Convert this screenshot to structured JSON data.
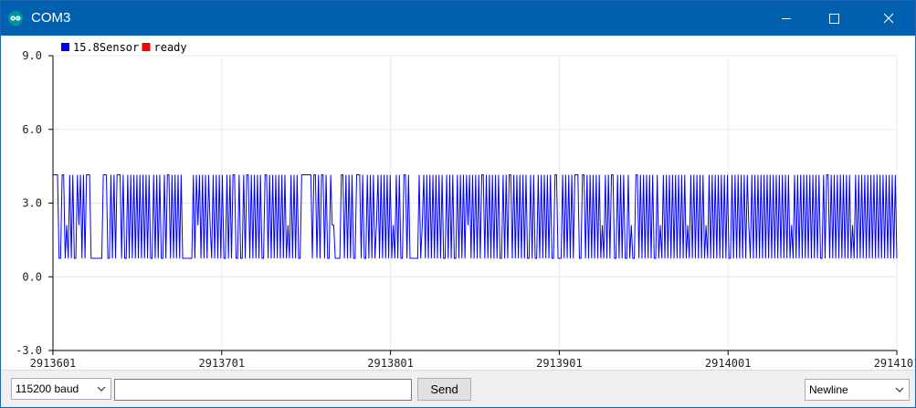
{
  "window": {
    "title": "COM3",
    "icon": "arduino-icon",
    "controls": [
      "minimize-icon",
      "maximize-icon",
      "close-icon"
    ]
  },
  "colors": {
    "titlebar": "#0060b0",
    "series_sensor": "#0000ff",
    "series_ready": "#ff0000",
    "grid": "#e8e8e8"
  },
  "legend": [
    {
      "label": "15.8Sensor",
      "color": "#0000ff"
    },
    {
      "label": "ready",
      "color": "#ff0000"
    }
  ],
  "chart_data": {
    "type": "line",
    "y_ticks": [
      "9.0",
      "6.0",
      "3.0",
      "0.0",
      "-3.0"
    ],
    "ylim": [
      -3.0,
      9.0
    ],
    "x_ticks": [
      "2913601",
      "2913701",
      "2913801",
      "2913901",
      "2914001",
      "2914101"
    ],
    "xlim": [
      2913601,
      2914101
    ],
    "grid": true,
    "legend_position": "top-left",
    "series": [
      {
        "name": "15.8Sensor",
        "color": "#0000ff",
        "levels": [
          0.75,
          2.1,
          4.15
        ],
        "values": [
          4.15,
          4.15,
          4.15,
          4.15,
          0.75,
          0.75,
          4.15,
          4.15,
          0.75,
          2.1,
          0.75,
          4.15,
          0.75,
          4.15,
          0.75,
          0.75,
          4.15,
          2.1,
          4.15,
          0.75,
          4.15,
          0.75,
          4.15,
          4.15,
          4.15,
          0.75,
          0.75,
          0.75,
          0.75,
          0.75,
          0.75,
          0.75,
          0.75,
          4.15,
          4.15,
          4.15,
          0.75,
          0.75,
          4.15,
          0.75,
          4.15,
          0.75,
          4.15,
          4.15,
          4.15,
          0.75,
          4.15,
          0.75,
          0.75,
          4.15,
          0.75,
          4.15,
          0.75,
          4.15,
          0.75,
          4.15,
          0.75,
          4.15,
          0.75,
          4.15,
          0.75,
          4.15,
          0.75,
          4.15,
          0.75,
          0.75,
          4.15,
          0.75,
          4.15,
          0.75,
          4.15,
          0.75,
          0.75,
          4.15,
          0.75,
          4.15,
          4.15,
          0.75,
          4.15,
          0.75,
          4.15,
          0.75,
          4.15,
          0.75,
          4.15,
          0.75,
          0.75,
          0.75,
          0.75,
          0.75,
          0.75,
          0.75,
          4.15,
          0.75,
          4.15,
          2.1,
          4.15,
          0.75,
          4.15,
          0.75,
          4.15,
          0.75,
          4.15,
          2.1,
          0.75,
          4.15,
          0.75,
          4.15,
          0.75,
          4.15,
          0.75,
          4.15,
          0.75,
          0.75,
          4.15,
          0.75,
          4.15,
          0.75,
          4.15,
          4.15,
          0.75,
          0.75,
          4.15,
          0.75,
          0.75,
          4.15,
          0.75,
          4.15,
          4.15,
          0.75,
          4.15,
          0.75,
          4.15,
          0.75,
          4.15,
          0.75,
          4.15,
          0.75,
          0.75,
          4.15,
          4.15,
          0.75,
          4.15,
          0.75,
          4.15,
          0.75,
          4.15,
          0.75,
          4.15,
          0.75,
          4.15,
          0.75,
          4.15,
          0.75,
          2.1,
          0.75,
          4.15,
          0.75,
          4.15,
          0.75,
          4.15,
          0.75,
          0.75,
          4.15,
          4.15,
          4.15,
          4.15,
          4.15,
          4.15,
          4.15,
          0.75,
          4.15,
          4.15,
          0.75,
          4.15,
          0.75,
          4.15,
          4.15,
          0.75,
          4.15,
          0.75,
          0.75,
          4.15,
          2.1,
          2.1,
          0.75,
          0.75,
          0.75,
          0.75,
          4.15,
          4.15,
          0.75,
          4.15,
          0.75,
          4.15,
          0.75,
          4.15,
          0.75,
          0.75,
          4.15,
          4.15,
          4.15,
          0.75,
          4.15,
          0.75,
          0.75,
          4.15,
          0.75,
          4.15,
          0.75,
          4.15,
          0.75,
          2.1,
          4.15,
          0.75,
          4.15,
          0.75,
          4.15,
          0.75,
          4.15,
          0.75,
          4.15,
          0.75,
          2.1,
          0.75,
          4.15,
          0.75,
          4.15,
          0.75,
          0.75,
          4.15,
          4.15,
          0.75,
          4.15,
          0.75,
          0.75,
          0.75,
          0.75,
          0.75,
          0.75,
          4.15,
          0.75,
          2.1,
          4.15,
          0.75,
          4.15,
          0.75,
          4.15,
          0.75,
          4.15,
          0.75,
          4.15,
          0.75,
          4.15,
          0.75,
          4.15,
          0.75,
          0.75,
          4.15,
          0.75,
          4.15,
          0.75,
          4.15,
          0.75,
          0.75,
          4.15,
          0.75,
          4.15,
          0.75,
          4.15,
          0.75,
          4.15,
          2.1,
          4.15,
          0.75,
          4.15,
          0.75,
          4.15,
          0.75,
          4.15,
          0.75,
          4.15,
          4.15,
          0.75,
          4.15,
          0.75,
          4.15,
          0.75,
          4.15,
          0.75,
          4.15,
          0.75,
          4.15,
          0.75,
          0.75,
          4.15,
          0.75,
          4.15,
          0.75,
          4.15,
          4.15,
          0.75,
          4.15,
          0.75,
          4.15,
          0.75,
          4.15,
          0.75,
          4.15,
          0.75,
          4.15,
          0.75,
          0.75,
          4.15,
          0.75,
          4.15,
          0.75,
          0.75,
          4.15,
          0.75,
          4.15,
          0.75,
          4.15,
          0.75,
          4.15,
          0.75,
          4.15,
          0.75,
          0.75,
          4.15,
          4.15,
          0.75,
          0.75,
          0.75,
          4.15,
          0.75,
          4.15,
          0.75,
          4.15,
          0.75,
          4.15,
          0.75,
          4.15,
          4.15,
          4.15,
          0.75,
          0.75,
          4.15,
          4.15,
          0.75,
          4.15,
          0.75,
          4.15,
          0.75,
          4.15,
          0.75,
          4.15,
          0.75,
          4.15,
          0.75,
          2.1,
          0.75,
          4.15,
          0.75,
          4.15,
          0.75,
          4.15,
          4.15,
          0.75,
          0.75,
          4.15,
          0.75,
          4.15,
          0.75,
          4.15,
          0.75,
          0.75,
          4.15,
          0.75,
          2.1,
          0.75,
          0.75,
          4.15,
          4.15,
          0.75,
          4.15,
          0.75,
          4.15,
          0.75,
          4.15,
          0.75,
          4.15,
          0.75,
          4.15,
          0.75,
          0.75,
          4.15,
          0.75,
          2.1,
          0.75,
          4.15,
          0.75,
          4.15,
          0.75,
          4.15,
          0.75,
          4.15,
          0.75,
          4.15,
          0.75,
          4.15,
          0.75,
          4.15,
          0.75,
          4.15,
          0.75,
          2.1,
          0.75,
          4.15,
          0.75,
          4.15,
          0.75,
          4.15,
          0.75,
          4.15,
          0.75,
          4.15,
          0.75,
          2.1,
          0.75,
          4.15,
          0.75,
          4.15,
          0.75,
          4.15,
          0.75,
          4.15,
          0.75,
          4.15,
          0.75,
          4.15,
          0.75,
          4.15,
          0.75,
          0.75,
          4.15,
          0.75,
          4.15,
          0.75,
          4.15,
          0.75,
          4.15,
          0.75,
          4.15,
          0.75,
          4.15,
          2.1,
          0.75,
          4.15,
          0.75,
          4.15,
          0.75,
          4.15,
          0.75,
          4.15,
          0.75,
          4.15,
          0.75,
          4.15,
          0.75,
          4.15,
          0.75,
          4.15,
          0.75,
          4.15,
          0.75,
          4.15,
          0.75,
          4.15,
          0.75,
          4.15,
          0.75,
          4.15,
          0.75,
          2.1,
          0.75,
          4.15,
          0.75,
          4.15,
          0.75,
          4.15,
          0.75,
          4.15,
          0.75,
          4.15,
          0.75,
          4.15,
          0.75,
          4.15,
          0.75,
          4.15,
          0.75,
          4.15,
          0.75,
          0.75,
          4.15,
          0.75,
          4.15,
          4.15,
          0.75,
          4.15,
          0.75,
          4.15,
          0.75,
          4.15,
          0.75,
          4.15,
          0.75,
          4.15,
          0.75,
          4.15,
          0.75,
          4.15,
          0.75,
          2.1,
          0.75,
          4.15,
          0.75,
          4.15,
          0.75,
          4.15,
          0.75,
          4.15,
          0.75,
          4.15,
          0.75,
          4.15,
          0.75,
          4.15,
          0.75,
          4.15,
          0.75,
          4.15,
          0.75,
          4.15,
          0.75,
          4.15,
          0.75,
          4.15,
          0.75,
          4.15,
          0.75,
          4.15,
          0.75
        ]
      },
      {
        "name": "ready",
        "color": "#ff0000",
        "values": []
      }
    ]
  },
  "bottom": {
    "baud": "115200 baud",
    "input_value": "",
    "send": "Send",
    "line_ending": "Newline"
  }
}
